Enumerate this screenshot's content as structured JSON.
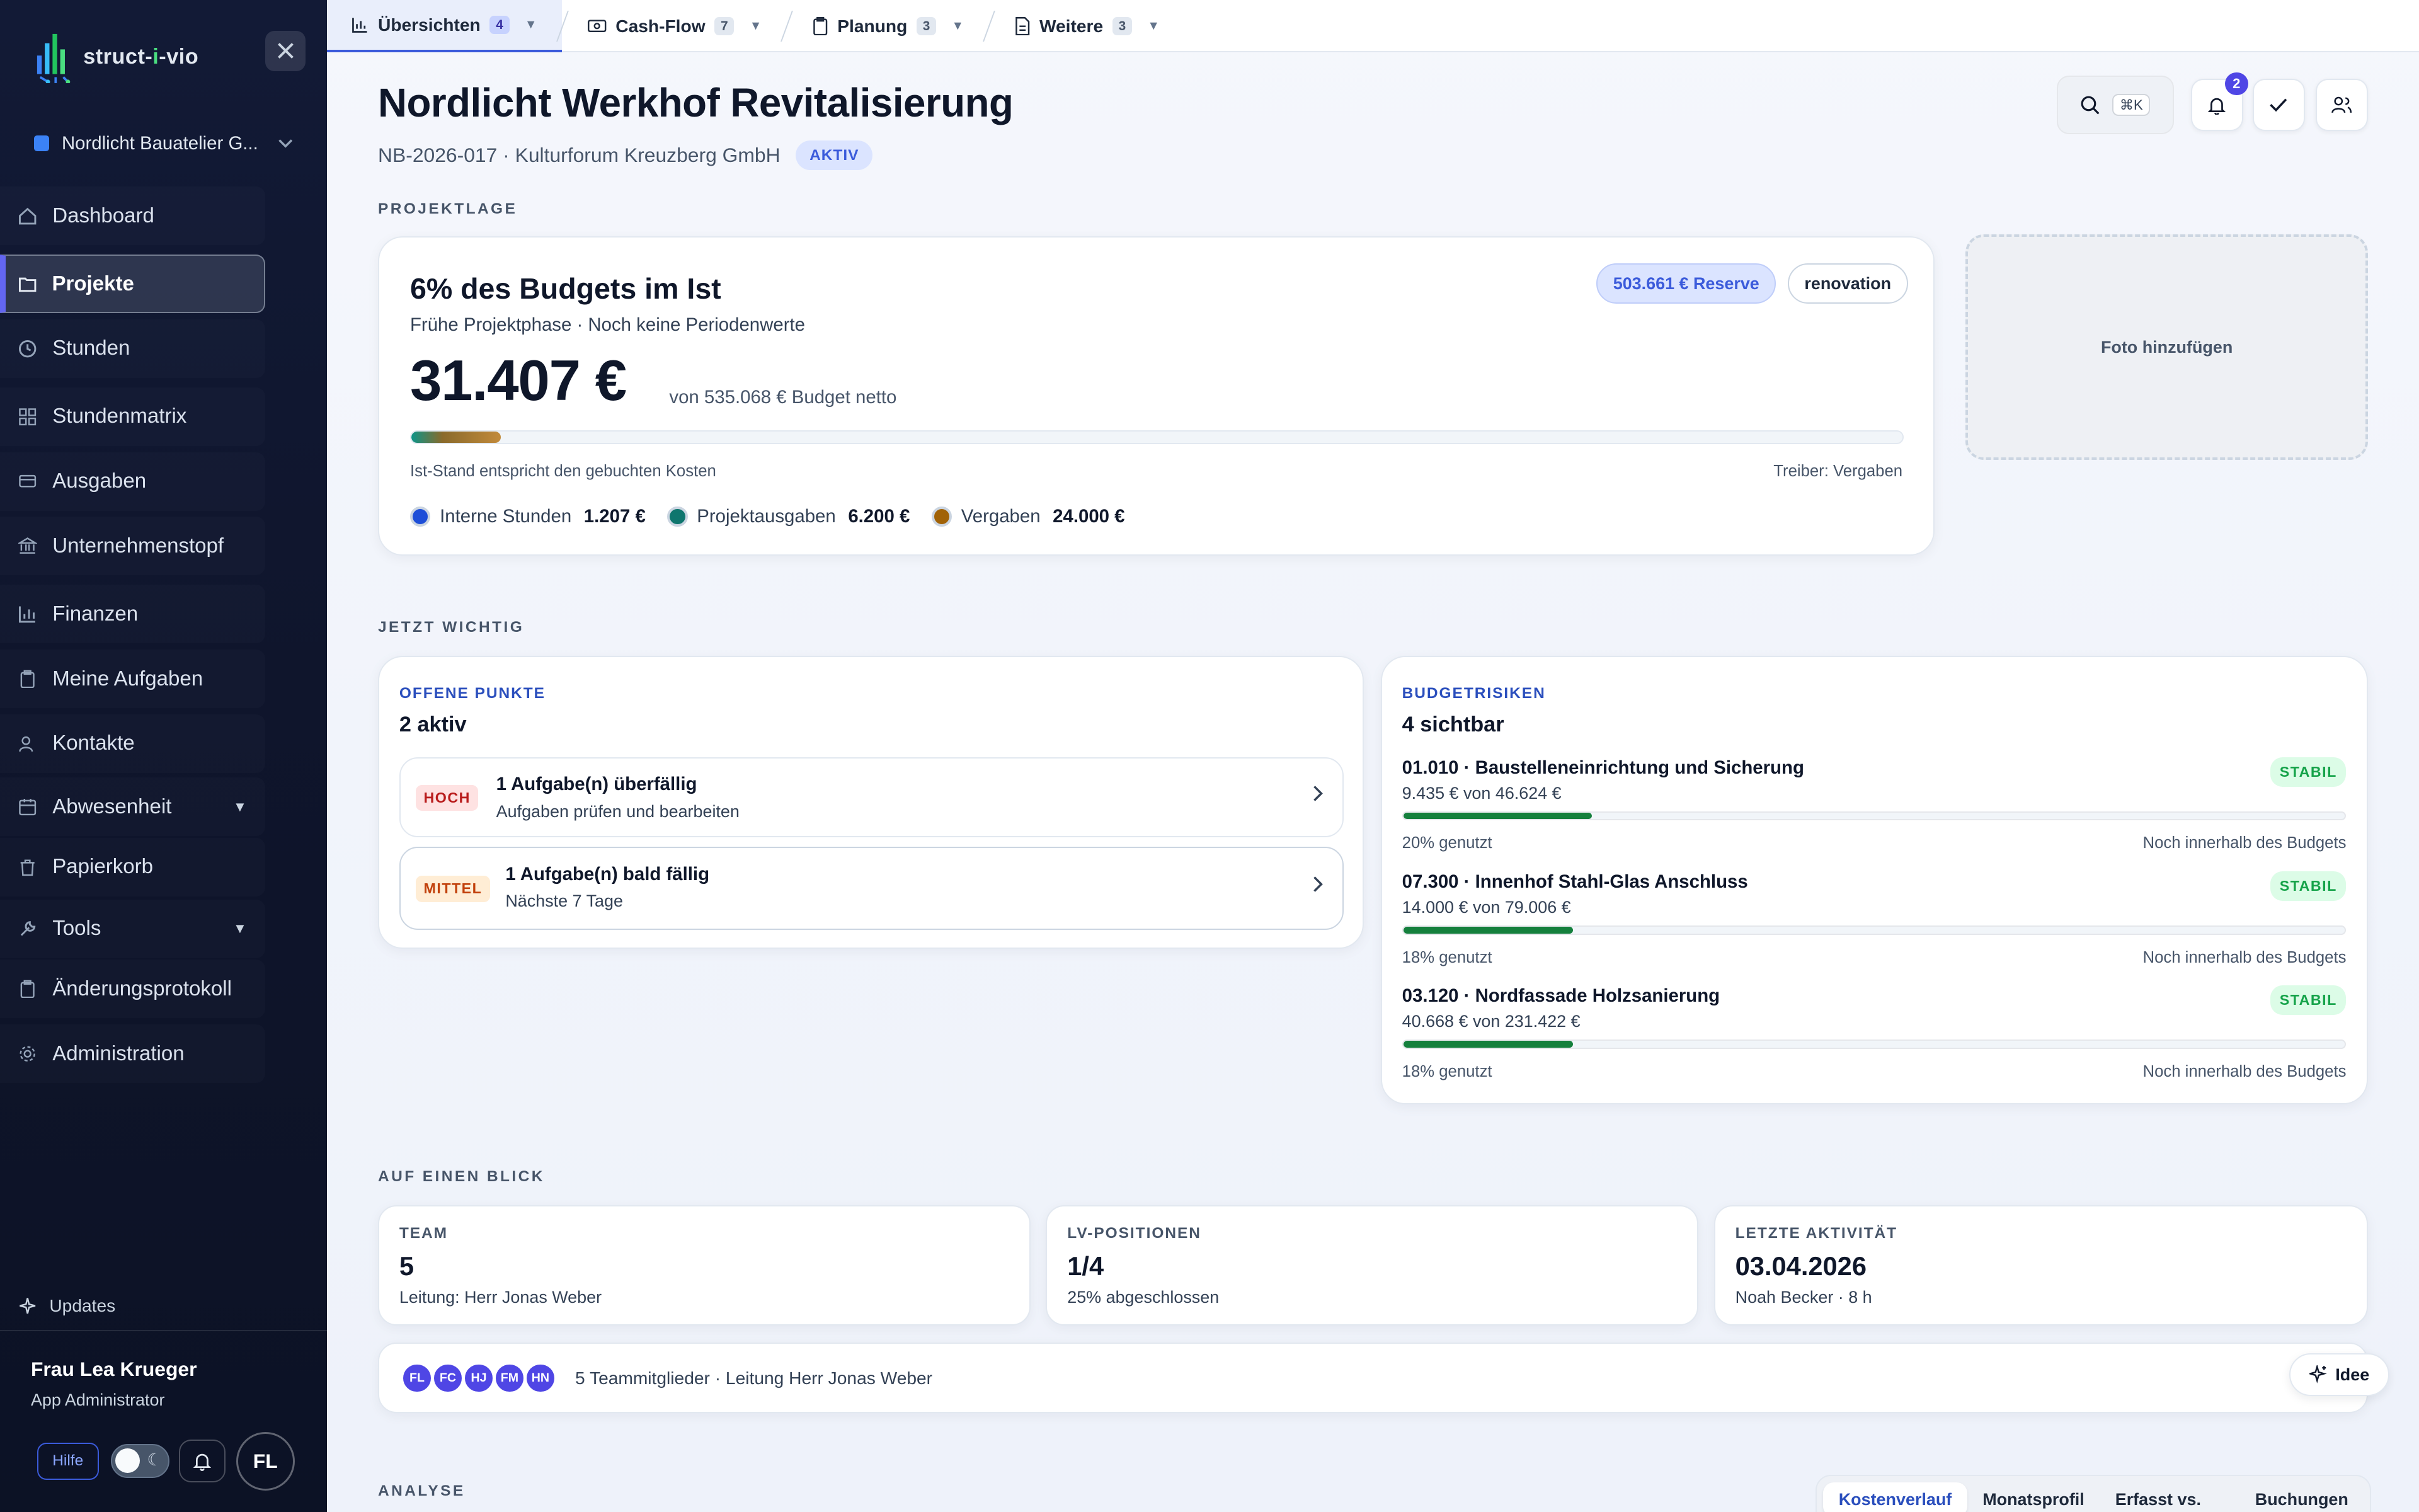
{
  "app": {
    "logo_text_a": "struct-",
    "logo_text_b": "i",
    "logo_text_c": "-vio"
  },
  "sidebar": {
    "org_name": "Nordlicht Bauatelier G...",
    "items": [
      {
        "label": "Dashboard",
        "icon": "home-icon"
      },
      {
        "label": "Projekte",
        "icon": "folder-icon",
        "active": true
      },
      {
        "label": "Stunden",
        "icon": "clock-icon"
      },
      {
        "label": "Stundenmatrix",
        "icon": "grid-icon"
      },
      {
        "label": "Ausgaben",
        "icon": "card-icon"
      },
      {
        "label": "Unternehmenstopf",
        "icon": "bank-icon"
      },
      {
        "label": "Finanzen",
        "icon": "chart-icon"
      },
      {
        "label": "Meine Aufgaben",
        "icon": "clipboard-icon"
      },
      {
        "label": "Kontakte",
        "icon": "users-icon"
      },
      {
        "label": "Abwesenheit",
        "icon": "calendar-icon"
      },
      {
        "label": "Papierkorb",
        "icon": "trash-icon"
      },
      {
        "label": "Tools",
        "icon": "wrench-icon"
      },
      {
        "label": "Änderungsprotokoll",
        "icon": "clipboard-icon"
      },
      {
        "label": "Administration",
        "icon": "gear-icon"
      }
    ],
    "updates_label": "Updates",
    "user_name": "Frau Lea Krueger",
    "user_role": "App Administrator",
    "help_label": "Hilfe",
    "avatar_initials": "FL"
  },
  "tabs": [
    {
      "label": "Übersichten",
      "count": "4"
    },
    {
      "label": "Cash-Flow",
      "count": "7"
    },
    {
      "label": "Planung",
      "count": "3"
    },
    {
      "label": "Weitere",
      "count": "3"
    }
  ],
  "header": {
    "title": "Nordlicht Werkhof Revitalisierung",
    "subtitle": "NB-2026-017 · Kulturforum Kreuzberg GmbH",
    "status": "AKTIV",
    "shortcut": "⌘K",
    "notification_count": "2"
  },
  "projektlage": {
    "section": "PROJEKTLAGE",
    "headline": "6% des Budgets im Ist",
    "sub": "Frühe Projektphase · Noch keine Periodenwerte",
    "reserve": "503.661 € Reserve",
    "tag": "renovation",
    "amount": "31.407 €",
    "of_budget": "von 535.068 € Budget netto",
    "progress_fraction": 0.06,
    "note_left": "Ist-Stand entspricht den gebuchten Kosten",
    "note_right": "Treiber: Vergaben",
    "legend": [
      {
        "label": "Interne Stunden",
        "value": "1.207 €",
        "color": "#1d4ed8"
      },
      {
        "label": "Projektausgaben",
        "value": "6.200 €",
        "color": "#0f766e"
      },
      {
        "label": "Vergaben",
        "value": "24.000 €",
        "color": "#a16207"
      }
    ],
    "photo_label": "Foto hinzufügen"
  },
  "wichtig": {
    "section": "JETZT WICHTIG",
    "offene": {
      "label": "OFFENE PUNKTE",
      "count": "2 aktiv",
      "items": [
        {
          "badge": "HOCH",
          "title": "1 Aufgabe(n) überfällig",
          "sub": "Aufgaben prüfen und bearbeiten"
        },
        {
          "badge": "MITTEL",
          "title": "1 Aufgabe(n) bald fällig",
          "sub": "Nächste 7 Tage"
        }
      ]
    },
    "risiken": {
      "label": "BUDGETRISIKEN",
      "count": "4 sichtbar",
      "items": [
        {
          "title": "01.010 · Baustelleneinrichtung und Sicherung",
          "amount": "9.435 € von 46.624 €",
          "status": "STABIL",
          "pct_label": "20% genutzt",
          "fraction": 0.2,
          "note": "Noch innerhalb des Budgets"
        },
        {
          "title": "07.300 · Innenhof Stahl-Glas Anschluss",
          "amount": "14.000 € von 79.006 €",
          "status": "STABIL",
          "pct_label": "18% genutzt",
          "fraction": 0.18,
          "note": "Noch innerhalb des Budgets"
        },
        {
          "title": "03.120 · Nordfassade Holzsanierung",
          "amount": "40.668 € von 231.422 €",
          "status": "STABIL",
          "pct_label": "18% genutzt",
          "fraction": 0.18,
          "note": "Noch innerhalb des Budgets"
        }
      ]
    }
  },
  "blick": {
    "section": "AUF EINEN BLICK",
    "stats": [
      {
        "label": "TEAM",
        "value": "5",
        "sub": "Leitung: Herr Jonas Weber"
      },
      {
        "label": "LV-POSITIONEN",
        "value": "1/4",
        "sub": "25% abgeschlossen"
      },
      {
        "label": "LETZTE AKTIVITÄT",
        "value": "03.04.2026",
        "sub": "Noah Becker · 8 h"
      }
    ],
    "avatars": [
      {
        "initials": "FL",
        "color": "#4f46e5"
      },
      {
        "initials": "FC",
        "color": "#4f46e5"
      },
      {
        "initials": "HJ",
        "color": "#4f46e5"
      },
      {
        "initials": "FM",
        "color": "#4f46e5"
      },
      {
        "initials": "HN",
        "color": "#4f46e5"
      }
    ],
    "team_line": "5 Teammitglieder · Leitung Herr Jonas Weber",
    "idee_label": "Idee"
  },
  "analyse": {
    "section": "ANALYSE",
    "tabs": [
      "Kostenverlauf",
      "Monatsprofil",
      "Erfasst vs. Ist",
      "Buchungen"
    ]
  }
}
